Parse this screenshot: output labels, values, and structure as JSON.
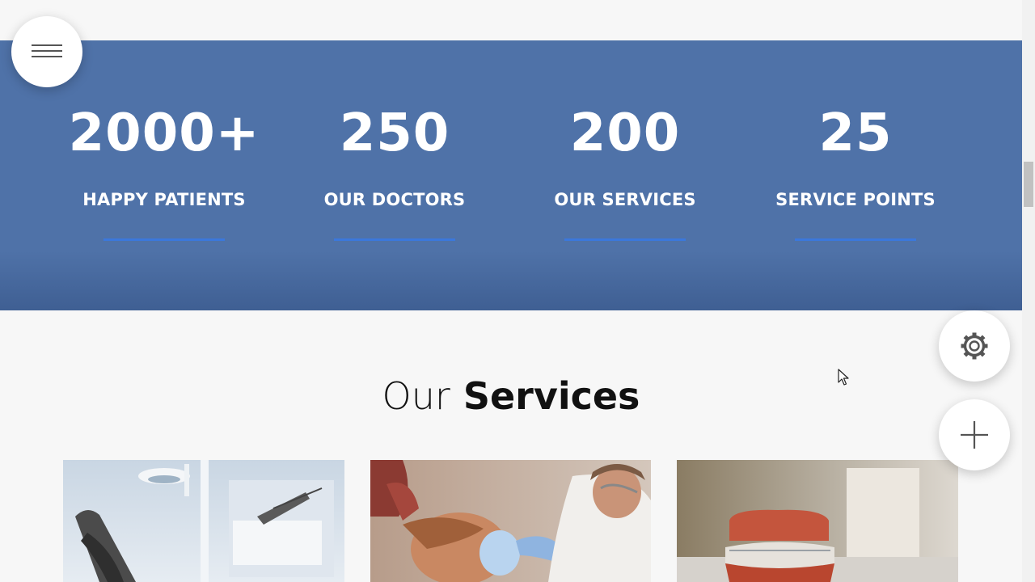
{
  "stats": [
    {
      "number": "2000+",
      "label": "HAPPY PATIENTS"
    },
    {
      "number": "250",
      "label": "OUR DOCTORS"
    },
    {
      "number": "200",
      "label": "OUR SERVICES"
    },
    {
      "number": "25",
      "label": "SERVICE POINTS"
    }
  ],
  "services": {
    "title_light": "Our",
    "title_bold": "Services"
  },
  "icons": {
    "menu": "hamburger-menu-icon",
    "settings": "gear-icon",
    "add": "plus-icon"
  },
  "colors": {
    "band": "#4f72a8",
    "underline": "#3b78dc",
    "text_on_band": "#ffffff",
    "title": "#111111"
  }
}
